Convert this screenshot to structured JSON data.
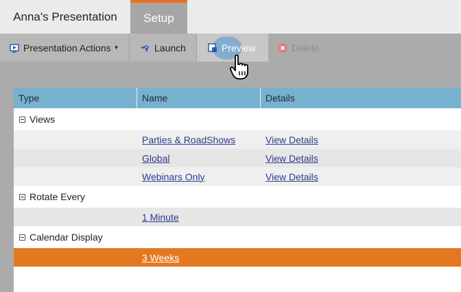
{
  "tabs": {
    "title": "Anna's Presentation",
    "setup": "Setup"
  },
  "toolbar": {
    "actions_label": "Presentation Actions",
    "launch_label": "Launch",
    "preview_label": "Preview",
    "delete_label": "Delete"
  },
  "table": {
    "headers": [
      "Type",
      "Name",
      "Details"
    ],
    "groups": [
      {
        "label": "Views",
        "rows": [
          {
            "name": "Parties & RoadShows",
            "details": "View Details"
          },
          {
            "name": "Global",
            "details": "View Details"
          },
          {
            "name": "Webinars Only",
            "details": "View Details"
          }
        ]
      },
      {
        "label": "Rotate Every",
        "rows": [
          {
            "name": "1 Minute"
          }
        ]
      },
      {
        "label": "Calendar Display",
        "rows": [
          {
            "name": "3 Weeks"
          }
        ]
      }
    ]
  },
  "colors": {
    "accent": "#e96f1f",
    "header_bg": "#76b2cf",
    "selected_row": "#e47820",
    "link": "#2f3a8c"
  }
}
